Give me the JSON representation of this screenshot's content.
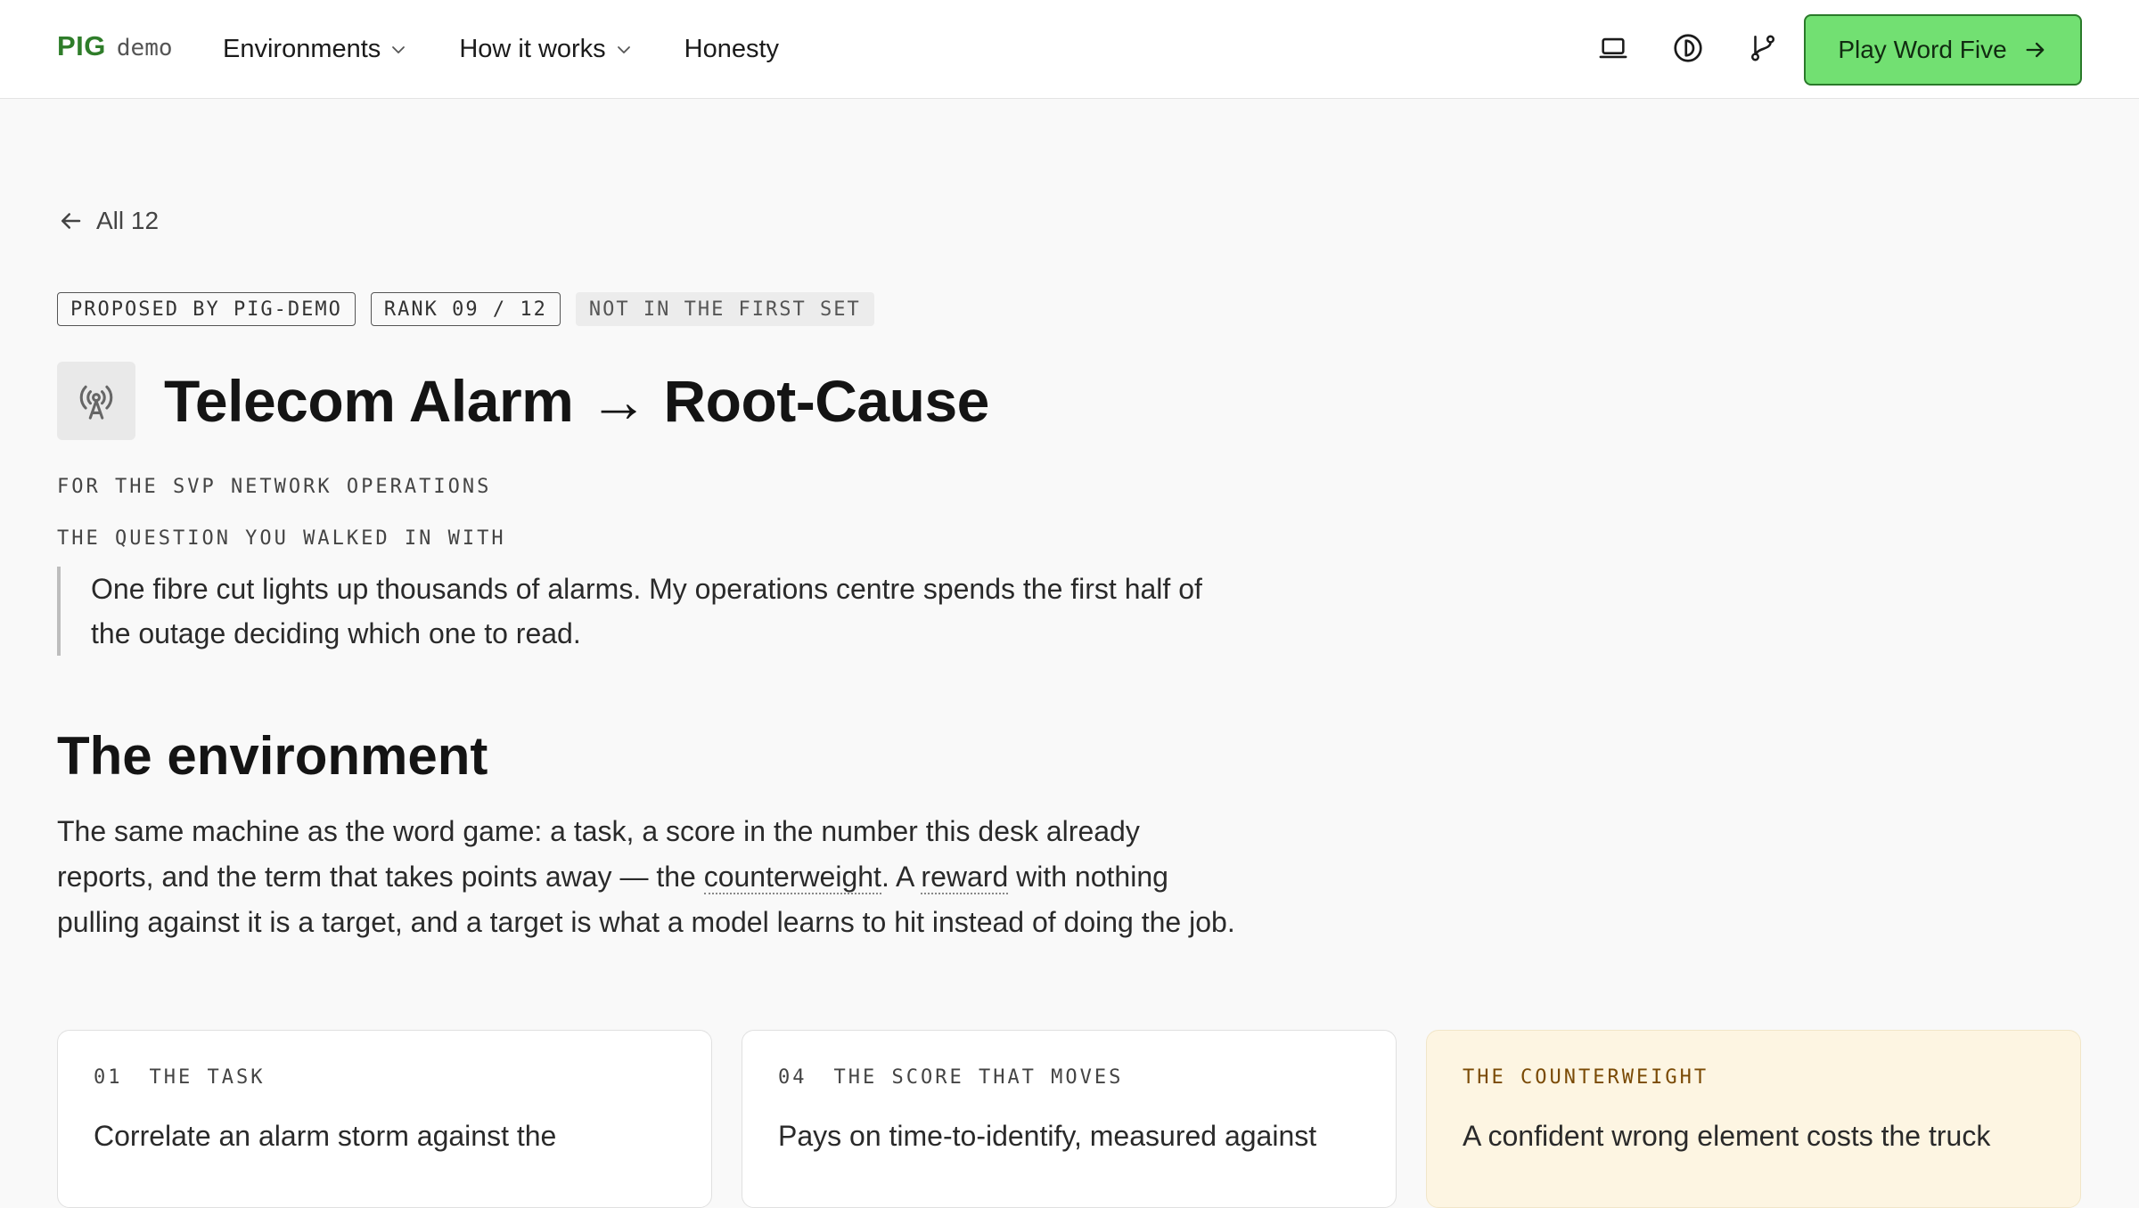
{
  "nav": {
    "brand": "PIG",
    "brand_suffix": "demo",
    "links": [
      {
        "label": "Environments",
        "has_dropdown": true
      },
      {
        "label": "How it works",
        "has_dropdown": true
      },
      {
        "label": "Honesty",
        "has_dropdown": false
      }
    ],
    "icons": [
      "laptop-icon",
      "contrast-icon",
      "branch-icon"
    ],
    "cta_label": "Play Word Five",
    "cta_color": "#72e072"
  },
  "back_link": "All 12",
  "badges": [
    "PROPOSED BY PIG-DEMO",
    "RANK 09 / 12",
    "NOT IN THE FIRST SET"
  ],
  "title": {
    "icon": "broadcast-tower-icon",
    "text": "Telecom Alarm → Root-Cause"
  },
  "audience": "FOR THE SVP NETWORK OPERATIONS",
  "question_label": "THE QUESTION YOU WALKED IN WITH",
  "question": "One fibre cut lights up thousands of alarms. My operations centre spends the first half of the outage deciding which one to read.",
  "environment": {
    "heading": "The environment",
    "p_before": "The same machine as the word game: a task, a score in the number this desk already reports, and the term that takes points away — the ",
    "term1": "counterweight",
    "p_mid": ". A ",
    "term2": "reward",
    "p_after": " with nothing pulling against it is a target, and a target is what a model learns to hit instead of doing the job."
  },
  "cards": [
    {
      "num": "01",
      "label": "THE TASK",
      "text": "Correlate an alarm storm against the"
    },
    {
      "num": "04",
      "label": "THE SCORE THAT MOVES",
      "text": "Pays on time-to-identify, measured against"
    },
    {
      "num": "",
      "label": "THE COUNTERWEIGHT",
      "text": "A confident wrong element costs the truck"
    }
  ]
}
